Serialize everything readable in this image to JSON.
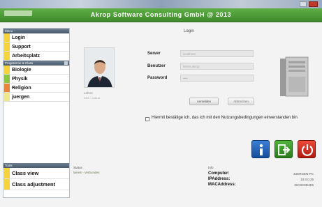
{
  "window": {
    "title": "Akrop Software Consulting GmbH @ 2013",
    "accent_color": "#4f9c38"
  },
  "sidebar": {
    "section_main": "Menu",
    "main_items": [
      {
        "label": "Login",
        "color": "#f5d33a"
      },
      {
        "label": "Support",
        "color": "#f5d33a"
      },
      {
        "label": "Arbeitsplatz",
        "color": "#f5d33a"
      }
    ],
    "section_subjects": "Programme & Class",
    "subject_items": [
      {
        "label": "Biologie",
        "color": "#f5d33a"
      },
      {
        "label": "Physik",
        "color": "#8cc63f"
      },
      {
        "label": "Religion",
        "color": "#e8833a"
      },
      {
        "label": "juergen",
        "color": "#f0e68c"
      }
    ],
    "section_tools": "Tools",
    "tool_items": [
      {
        "label": "Class view",
        "color": "#f5d33a"
      },
      {
        "label": "Class adjustment",
        "color": "#f5d33a"
      }
    ]
  },
  "main": {
    "tab_label": "Login",
    "user_caption": "Lehrer",
    "user_sub": "XXX - Lehrer",
    "server_label": "Server",
    "server_value": "localhost",
    "username_label": "Benutzer",
    "username_value": "lehrer.akrop",
    "password_label": "Password",
    "password_value": "••••",
    "ok_button": "Anmelden",
    "cancel_button": "Abbrechen",
    "terms_text": "Hiermit bestätige ich, das ich mit den Nutzungsbedingungen einverstanden bin",
    "info_icon": "info-icon",
    "exit_icon": "exit-arrow-icon",
    "power_icon": "power-icon"
  },
  "status": {
    "line1": "Status",
    "line2": "Bereit - Verbunden",
    "info_header": "Info",
    "computer_label": "Computer:",
    "computer_value": "JUERGEN-PC",
    "ip_label": "IPAddress:",
    "ip_value": "10.0.0.25",
    "mac_label": "MACAddress:",
    "mac_value": "00A0C9D4E6"
  }
}
